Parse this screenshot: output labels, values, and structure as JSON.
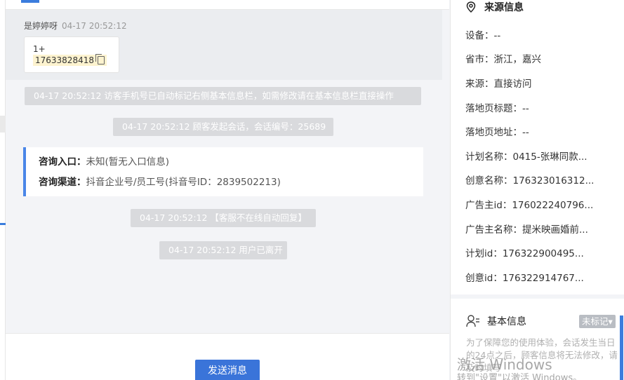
{
  "chat": {
    "sender_name": "是婷婷呀",
    "sender_time": "04-17 20:52:12",
    "bubble_line1": "1+",
    "bubble_phone": "17633828418",
    "system_messages": [
      "04-17 20:52:12 访客手机号已自动标记右侧基本信息栏，如需修改请在基本信息栏直接操作",
      "04-17 20:52:12 顾客发起会话，会话编号：25689",
      "04-17 20:52:12 【客服不在线自动回复】",
      "04-17 20:52:12 用户已离开"
    ],
    "consult": {
      "entry_label": "咨询入口：",
      "entry_value": "未知(暂无入口信息)",
      "channel_label": "咨询渠道：",
      "channel_value": "抖音企业号/员工号(抖音号ID：2839502213)"
    },
    "send_button": "发送消息"
  },
  "panel": {
    "source_title": "来源信息",
    "source_fields": [
      {
        "label": "设备：",
        "value": "--"
      },
      {
        "label": "省市：",
        "value": "浙江，嘉兴"
      },
      {
        "label": "来源：",
        "value": "直接访问"
      },
      {
        "label": "落地页标题：",
        "value": "--"
      },
      {
        "label": "落地页地址：",
        "value": "--"
      },
      {
        "label": "计划名称：",
        "value": "0415-张琳同款..."
      },
      {
        "label": "创意名称：",
        "value": "176323016312..."
      },
      {
        "label": "广告主id：",
        "value": "176022240796..."
      },
      {
        "label": "广告主名称：",
        "value": "提米映画婚前..."
      },
      {
        "label": "计划id：",
        "value": "176322900495..."
      },
      {
        "label": "创意id：",
        "value": "176322914767..."
      }
    ],
    "basic_title": "基本信息",
    "tag_label": "未标记",
    "note_text": "为了保障您的使用体验，会话发生当日的24点之后，顾客信息将无法修改，请及时填写"
  },
  "watermark": {
    "line1": "激活 Windows",
    "line2": "转到\"设置\"以激活 Windows。"
  }
}
